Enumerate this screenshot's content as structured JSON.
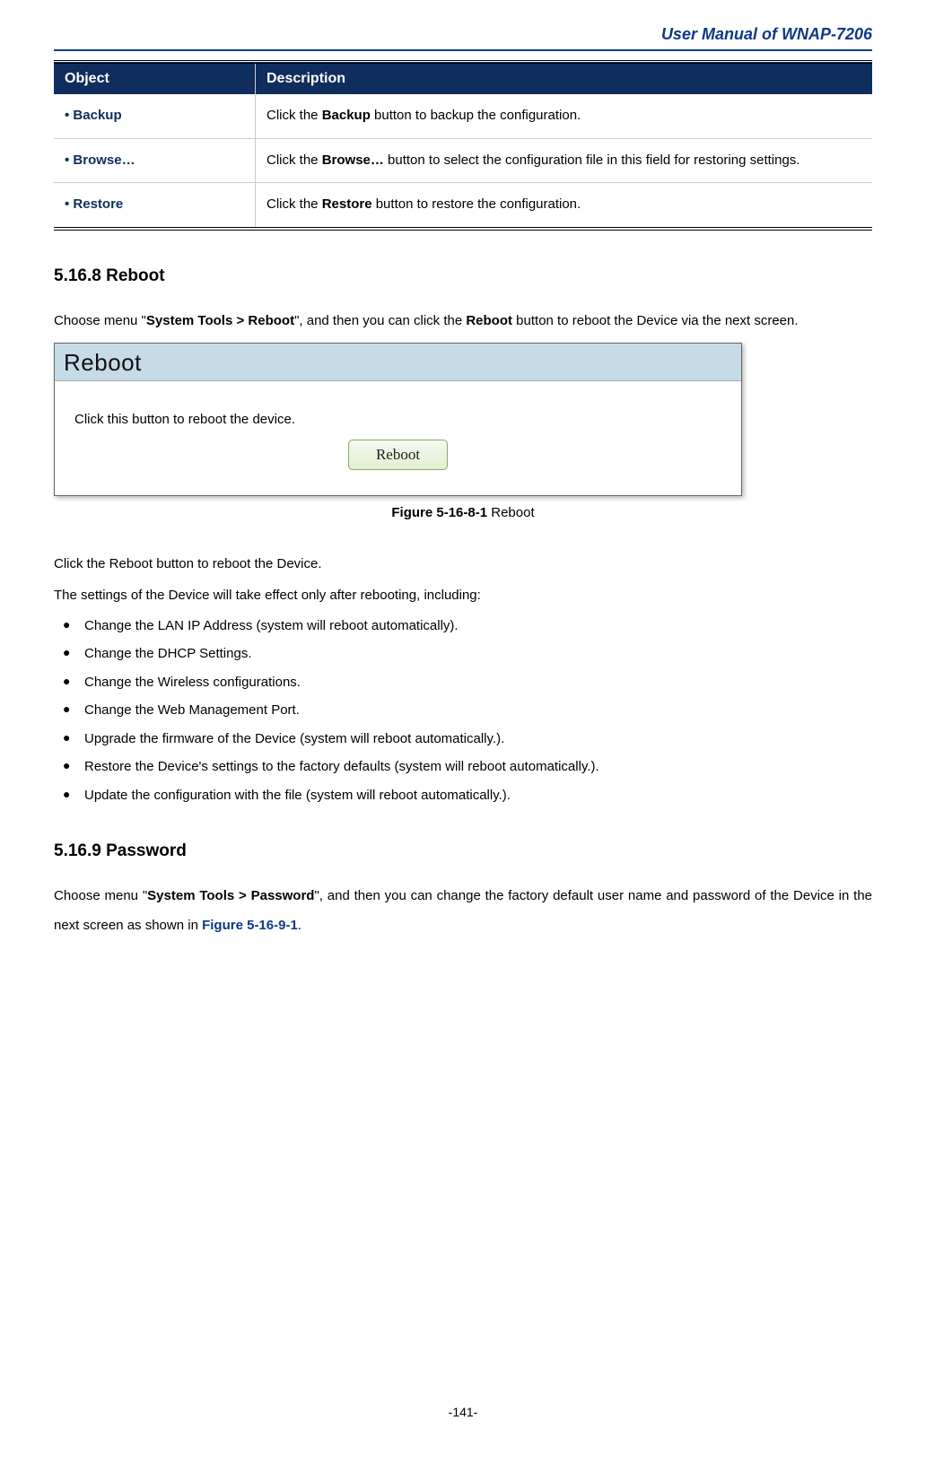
{
  "header": {
    "title": "User Manual of WNAP-7206"
  },
  "table": {
    "headers": {
      "object": "Object",
      "description": "Description"
    },
    "rows": [
      {
        "object": "Backup",
        "desc_pre": "Click the ",
        "desc_bold": "Backup",
        "desc_post": " button to backup the configuration."
      },
      {
        "object": "Browse…",
        "desc_pre": "Click the ",
        "desc_bold": "Browse…",
        "desc_post": " button to select the configuration file in this field for restoring settings."
      },
      {
        "object": "Restore",
        "desc_pre": "Click the ",
        "desc_bold": "Restore",
        "desc_post": " button to restore the configuration."
      }
    ]
  },
  "section_reboot": {
    "heading": "5.16.8 Reboot",
    "intro_pre": "Choose menu \"",
    "intro_bold": "System Tools > Reboot",
    "intro_mid": "\", and then you can click the ",
    "intro_bold2": "Reboot",
    "intro_post": " button to reboot the Device via the next screen.",
    "figure": {
      "panel_title": "Reboot",
      "body_text": "Click this button to reboot the device.",
      "button_label": "Reboot",
      "caption_bold": "Figure 5-16-8-1",
      "caption_rest": " Reboot"
    },
    "after_p1": "Click the Reboot button to reboot the Device.",
    "after_p2": "The settings of the Device will take effect only after rebooting, including:",
    "bullets": [
      "Change the LAN IP Address (system will reboot automatically).",
      "Change the DHCP Settings.",
      "Change the Wireless configurations.",
      "Change the Web Management Port.",
      "Upgrade the firmware of the Device (system will reboot automatically.).",
      "Restore the Device's settings to the factory defaults (system will reboot automatically.).",
      "Update the configuration with the file (system will reboot automatically.)."
    ]
  },
  "section_password": {
    "heading": "5.16.9 Password",
    "intro_pre": "Choose menu \"",
    "intro_bold": "System Tools > Password",
    "intro_mid": "\", and then you can change the factory default user name and password of the Device in the next screen as shown in ",
    "intro_link": "Figure 5-16-9-1",
    "intro_post": "."
  },
  "footer": {
    "page": "-141-"
  }
}
